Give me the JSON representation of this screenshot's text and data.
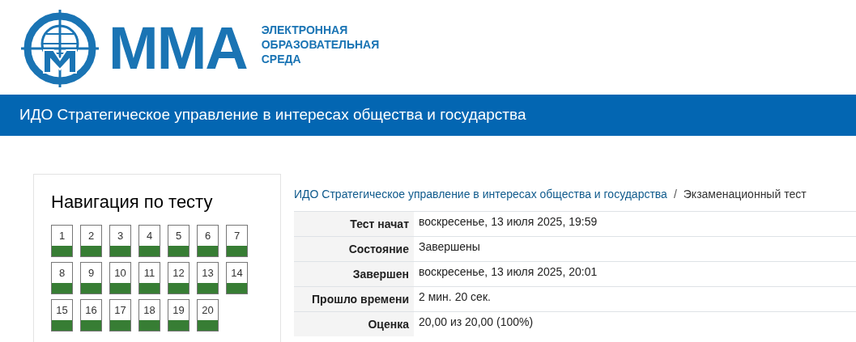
{
  "logo": {
    "wordmark": "ММА",
    "tagline": [
      "ЭЛЕКТРОННАЯ",
      "ОБРАЗОВАТЕЛЬНАЯ",
      "СРЕДА"
    ]
  },
  "course_bar": {
    "title": "ИДО Стратегическое управление в интересах общества и государства"
  },
  "quiz_navigation": {
    "title": "Навигация по тесту",
    "questions": [
      {
        "label": "1",
        "answered": true
      },
      {
        "label": "2",
        "answered": true
      },
      {
        "label": "3",
        "answered": true
      },
      {
        "label": "4",
        "answered": true
      },
      {
        "label": "5",
        "answered": true
      },
      {
        "label": "6",
        "answered": true
      },
      {
        "label": "7",
        "answered": true
      },
      {
        "label": "8",
        "answered": true
      },
      {
        "label": "9",
        "answered": true
      },
      {
        "label": "10",
        "answered": true
      },
      {
        "label": "11",
        "answered": true
      },
      {
        "label": "12",
        "answered": true
      },
      {
        "label": "13",
        "answered": true
      },
      {
        "label": "14",
        "answered": true
      },
      {
        "label": "15",
        "answered": true
      },
      {
        "label": "16",
        "answered": true
      },
      {
        "label": "17",
        "answered": true
      },
      {
        "label": "18",
        "answered": true
      },
      {
        "label": "19",
        "answered": true
      },
      {
        "label": "20",
        "answered": true
      }
    ]
  },
  "breadcrumb": {
    "link": "ИДО Стратегическое управление в интересах общества и государства",
    "separator": "/",
    "current": "Экзаменационный тест"
  },
  "summary": [
    {
      "label": "Тест начат",
      "value": "воскресенье, 13 июля 2025, 19:59"
    },
    {
      "label": "Состояние",
      "value": "Завершены"
    },
    {
      "label": "Завершен",
      "value": "воскресенье, 13 июля 2025, 20:01"
    },
    {
      "label": "Прошло времени",
      "value": "2 мин. 20 сек."
    },
    {
      "label": "Оценка",
      "value": "20,00 из 20,00 (100%)"
    }
  ]
}
